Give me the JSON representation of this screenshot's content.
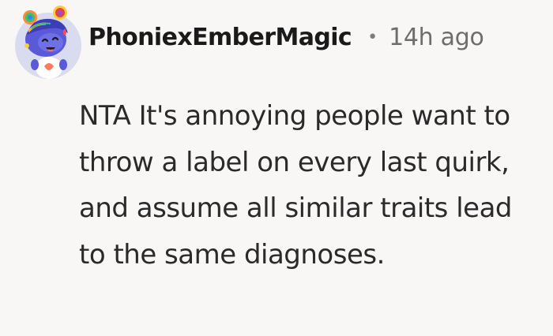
{
  "comment": {
    "username": "PhoniexEmberMagic",
    "separator": "•",
    "timestamp": "14h ago",
    "text": "NTA It's annoying people want to throw a label on every last quirk, and assume all similar traits lead to the same diagnoses."
  },
  "avatar": {
    "icon": "snoo-avatar-icon",
    "background_color": "#d9dcef",
    "body_color": "#5a5ad8"
  }
}
